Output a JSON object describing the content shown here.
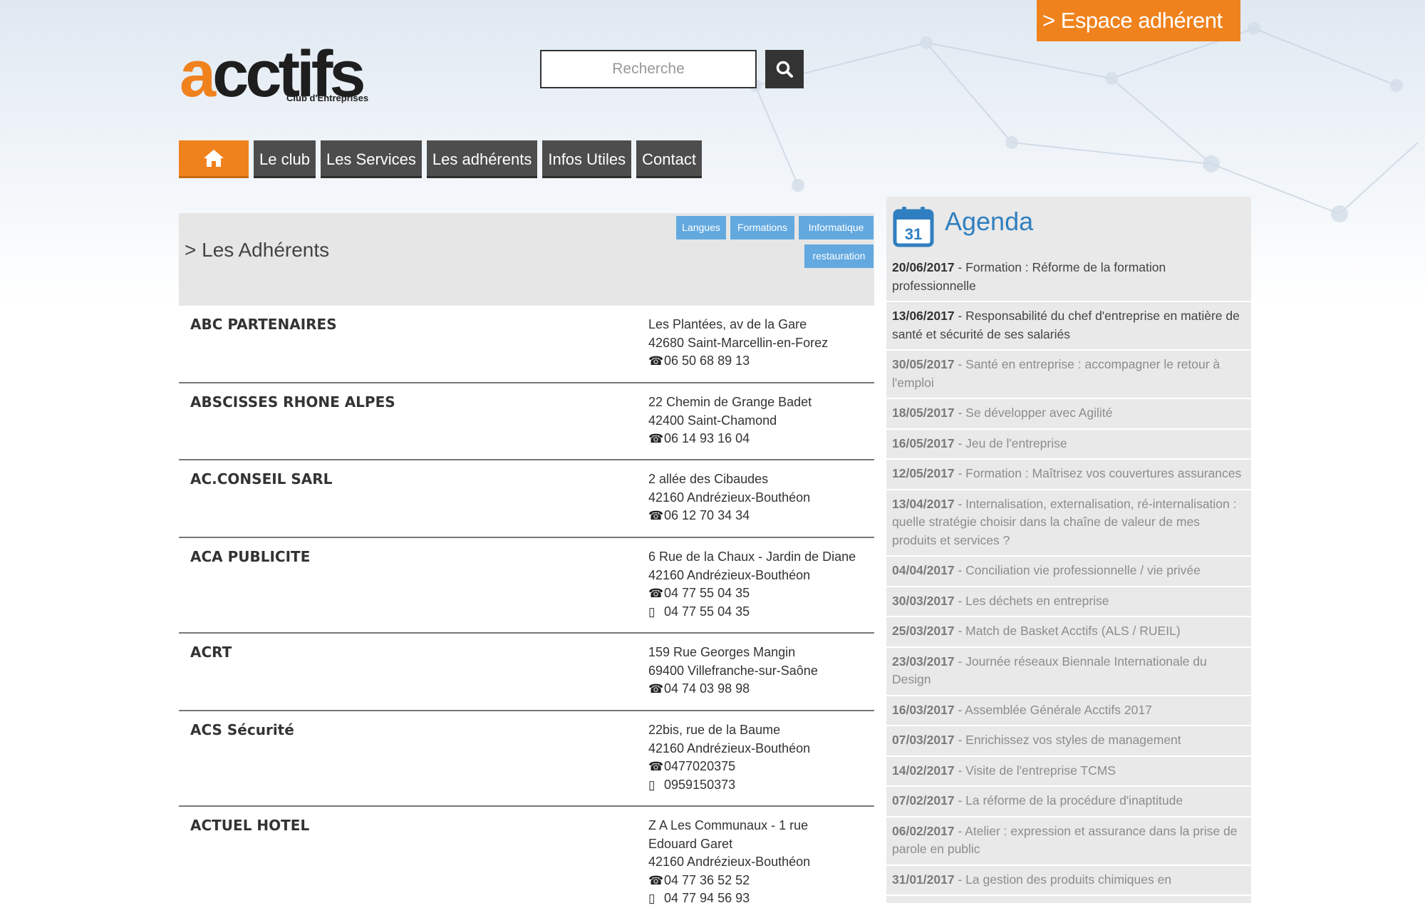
{
  "header": {
    "espace_adherent": "> Espace adhérent",
    "logo_text": "acctifs",
    "logo_subtitle": "Club d'Entreprises",
    "search_placeholder": "Recherche"
  },
  "nav": {
    "home_icon": "home-icon",
    "items": [
      "Le club",
      "Les Services",
      "Les adhérents",
      "Infos Utiles",
      "Contact"
    ]
  },
  "main": {
    "title": "> Les Adhérents",
    "tags": [
      "Langues",
      "Formations",
      "Informatique",
      "restauration"
    ],
    "members": [
      {
        "name": "ABC PARTENAIRES",
        "lines": [
          "Les Plantées, av de la Gare",
          "42680 Saint-Marcellin-en-Forez"
        ],
        "phone": "06 50 68 89 13",
        "mobile": ""
      },
      {
        "name": "ABSCISSES RHONE ALPES",
        "lines": [
          "22 Chemin de Grange Badet",
          "42400 Saint-Chamond"
        ],
        "phone": "06 14 93 16 04",
        "mobile": ""
      },
      {
        "name": "AC.CONSEIL SARL",
        "lines": [
          "2 allée des Cibaudes",
          "42160 Andrézieux-Bouthéon"
        ],
        "phone": "06 12 70 34 34",
        "mobile": ""
      },
      {
        "name": "ACA PUBLICITE",
        "lines": [
          "6 Rue de la Chaux - Jardin de Diane",
          "42160 Andrézieux-Bouthéon"
        ],
        "phone": "04 77 55 04 35",
        "mobile": "04 77 55 04 35"
      },
      {
        "name": "ACRT",
        "lines": [
          "159 Rue Georges Mangin",
          "69400 Villefranche-sur-Saône"
        ],
        "phone": "04 74 03 98 98",
        "mobile": ""
      },
      {
        "name": "ACS Sécurité",
        "lines": [
          "22bis, rue de la Baume",
          "42160 Andrézieux-Bouthéon"
        ],
        "phone": "0477020375",
        "mobile": "0959150373"
      },
      {
        "name": "ACTUEL HOTEL",
        "lines": [
          "Z A Les Communaux - 1 rue",
          "Edouard Garet",
          "42160 Andrézieux-Bouthéon"
        ],
        "phone": "04 77 36 52 52",
        "mobile": "04 77 94 56 93"
      }
    ]
  },
  "agenda": {
    "title": "Agenda",
    "calendar_day": "31",
    "items": [
      {
        "date": "20/06/2017",
        "text": " - Formation : Réforme de la formation professionnelle"
      },
      {
        "date": "13/06/2017",
        "text": " - Responsabilité du chef d'entreprise en matière de santé et sécurité de ses salariés"
      },
      {
        "date": "30/05/2017",
        "text": " - Santé en entreprise : accompagner le retour à l'emploi"
      },
      {
        "date": "18/05/2017",
        "text": " - Se développer avec Agilité"
      },
      {
        "date": "16/05/2017",
        "text": " - Jeu de l'entreprise"
      },
      {
        "date": "12/05/2017",
        "text": " - Formation : Maîtrisez vos couvertures assurances"
      },
      {
        "date": "13/04/2017",
        "text": " - Internalisation, externalisation, ré-internalisation : quelle stratégie choisir dans la chaîne de valeur de mes produits et services ?"
      },
      {
        "date": "04/04/2017",
        "text": " - Conciliation vie professionnelle / vie privée"
      },
      {
        "date": "30/03/2017",
        "text": " - Les déchets en entreprise"
      },
      {
        "date": "25/03/2017",
        "text": " - Match de Basket Acctifs (ALS / RUEIL)"
      },
      {
        "date": "23/03/2017",
        "text": " - Journée réseaux Biennale Internationale du Design"
      },
      {
        "date": "16/03/2017",
        "text": " - Assemblée Générale Acctifs 2017"
      },
      {
        "date": "07/03/2017",
        "text": " - Enrichissez vos styles de management"
      },
      {
        "date": "14/02/2017",
        "text": " - Visite de l'entreprise TCMS"
      },
      {
        "date": "07/02/2017",
        "text": " - La réforme de la procédure d'inaptitude"
      },
      {
        "date": "06/02/2017",
        "text": " - Atelier : expression et assurance dans la prise de parole en public"
      },
      {
        "date": "31/01/2017",
        "text": " - La gestion des produits chimiques en"
      }
    ]
  },
  "colors": {
    "accent": "#f0821e",
    "nav": "#4d4d4d",
    "tag": "#63a9e0",
    "agenda_title": "#2f7fc0"
  }
}
